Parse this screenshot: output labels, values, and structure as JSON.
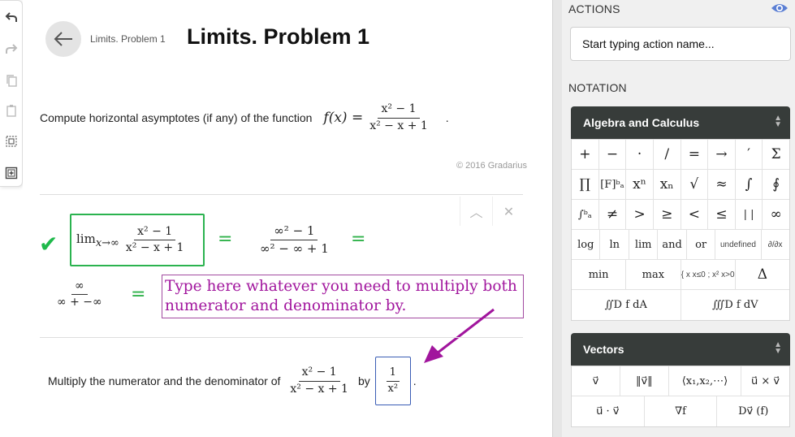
{
  "toolbar": {
    "icons": [
      "undo-icon",
      "redo-icon",
      "copy-icon",
      "paste-icon",
      "select-icon",
      "add-icon"
    ]
  },
  "header": {
    "breadcrumb": "Limits. Problem 1",
    "title": "Limits. Problem 1"
  },
  "problem": {
    "statement": "Compute horizontal asymptotes (if any) of the function",
    "fx": "f(x) =",
    "numerator": "x² − 1",
    "denominator": "x² − x + 1",
    "period": ".",
    "copyright": "© 2016 Gradarius"
  },
  "step": {
    "lim_label": "lim",
    "lim_sub": "x→∞",
    "numerator": "x² − 1",
    "denominator": "x² − x + 1",
    "eq": "=",
    "expr2_num": "∞² − 1",
    "expr2_den": "∞² − ∞ + 1",
    "expr3_num": "∞",
    "expr3_den": "∞ + −∞",
    "annotation": "Type here whatever you need to multiply both numerator and denominator by."
  },
  "multiply": {
    "text": "Multiply the numerator and the denominator of",
    "numerator": "x² − 1",
    "denominator": "x² − x + 1",
    "by": "by",
    "input_num": "1",
    "input_den": "x²",
    "period": "."
  },
  "panel": {
    "actions_title": "ACTIONS",
    "action_placeholder": "Start typing action name...",
    "notation_title": "NOTATION",
    "algebra_title": "Algebra and Calculus",
    "vectors_title": "Vectors",
    "algebra_rows": [
      [
        "+",
        "−",
        "·",
        "/",
        "=",
        "→",
        "′",
        "Σ"
      ],
      [
        "∏",
        "[F]ᵇₐ",
        "xⁿ",
        "xₙ",
        "√",
        "≈",
        "∫",
        "∮"
      ],
      [
        "∫ᵇₐ",
        "≠",
        ">",
        "≥",
        "<",
        "≤",
        "| |",
        "∞"
      ],
      [
        "log",
        "ln",
        "lim",
        "and",
        "or",
        "undefined",
        "∂/∂x"
      ],
      [
        "min",
        "max",
        "{ x x≤0 ; x² x>0",
        "Δ"
      ],
      [
        "∬D f dA",
        "∭D f dV"
      ]
    ],
    "vector_rows": [
      [
        "v⃗",
        "‖v⃗‖",
        "⟨x₁,x₂,⋯⟩",
        "u⃗ × v⃗"
      ],
      [
        "u⃗ · v⃗",
        "∇f",
        "Dv⃗ (f)"
      ]
    ]
  },
  "colors": {
    "correct": "#2bb34f",
    "annotation": "#a1159d",
    "header_dark": "#373c3a",
    "eye": "#5b7fd4"
  }
}
